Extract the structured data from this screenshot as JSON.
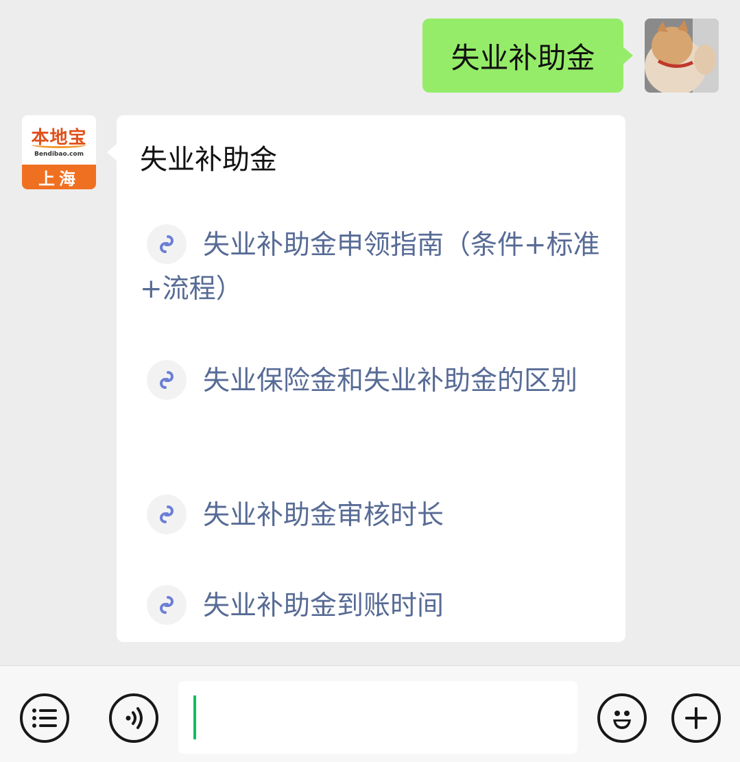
{
  "outgoing": {
    "text": "失业补助金"
  },
  "bot": {
    "avatar_logo_text": "本地宝",
    "avatar_logo_sub": "Bendibao.com",
    "avatar_city": "上海"
  },
  "incoming": {
    "title": "失业补助金",
    "links": [
      {
        "label": "失业补助金申领指南（条件+标准+流程）",
        "icon": "mini-program-link-icon"
      },
      {
        "label": "失业保险金和失业补助金的区别",
        "icon": "mini-program-link-icon"
      },
      {
        "label": "失业补助金审核时长",
        "icon": "mini-program-link-icon"
      },
      {
        "label": "失业补助金到账时间",
        "icon": "mini-program-link-icon"
      }
    ]
  },
  "input_bar": {
    "menu_icon": "menu-list-icon",
    "voice_icon": "voice-icon",
    "emoji_icon": "emoji-icon",
    "plus_icon": "plus-icon",
    "value": ""
  },
  "colors": {
    "background": "#ededed",
    "outgoing_bubble": "#95ec69",
    "link_text": "#576b95",
    "caret": "#07c160",
    "brand_orange": "#f07021"
  }
}
